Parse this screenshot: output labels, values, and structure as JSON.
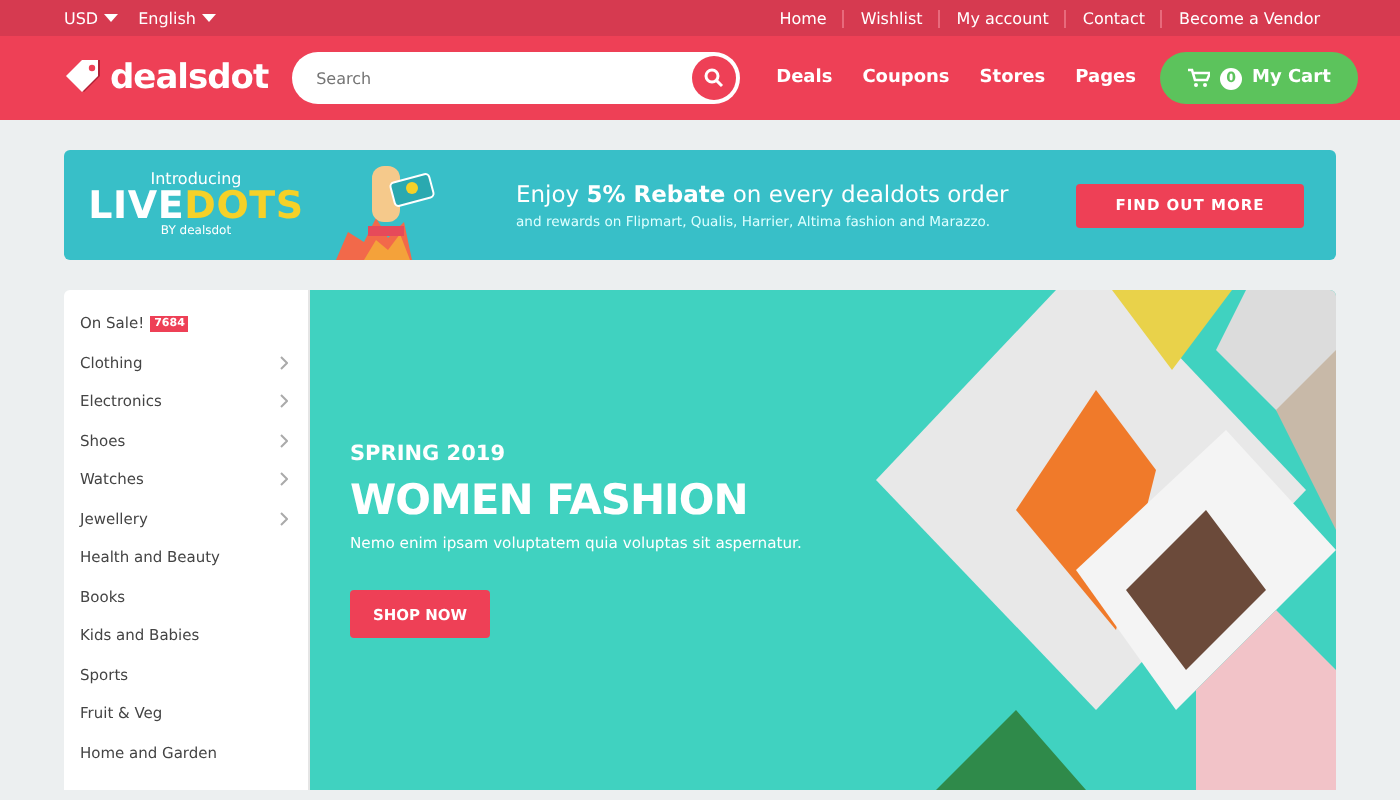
{
  "top_bar": {
    "selectors": [
      {
        "label": "USD"
      },
      {
        "label": "English"
      }
    ],
    "links": [
      "Home",
      "Wishlist",
      "My account",
      "Contact",
      "Become a Vendor"
    ]
  },
  "header": {
    "logo": "dealsdot",
    "search": {
      "placeholder": "Search"
    },
    "nav": [
      "Deals",
      "Coupons",
      "Stores",
      "Pages"
    ],
    "cart": {
      "count": "0",
      "label": "My Cart"
    }
  },
  "promo_banner": {
    "intro": "Introducing",
    "brand_part_1": "LIVE",
    "brand_part_2": "DOTS",
    "byline": "BY dealsdot",
    "headline": "Enjoy **5% Rebate** on every dealdots order",
    "subline": "and rewards on Flipmart, Qualis, Harrier, Altima fashion and Marazzo.",
    "button": "FIND OUT MORE"
  },
  "categories": [
    {
      "label": "On Sale!",
      "badge": "7684",
      "has_submenu": false
    },
    {
      "label": "Clothing",
      "has_submenu": true
    },
    {
      "label": "Electronics",
      "has_submenu": true
    },
    {
      "label": "Shoes",
      "has_submenu": true
    },
    {
      "label": "Watches",
      "has_submenu": true
    },
    {
      "label": "Jewellery",
      "has_submenu": true
    },
    {
      "label": "Health and Beauty",
      "has_submenu": false
    },
    {
      "label": "Books",
      "has_submenu": false
    },
    {
      "label": "Kids and Babies",
      "has_submenu": false
    },
    {
      "label": "Sports",
      "has_submenu": false
    },
    {
      "label": "Fruit & Veg",
      "has_submenu": false
    },
    {
      "label": "Home and Garden",
      "has_submenu": false
    }
  ],
  "hero": {
    "eyebrow": "SPRING 2019",
    "title": "WOMEN FASHION",
    "text": "Nemo enim ipsam voluptatem quia voluptas sit aspernatur.",
    "button": "SHOP NOW"
  }
}
